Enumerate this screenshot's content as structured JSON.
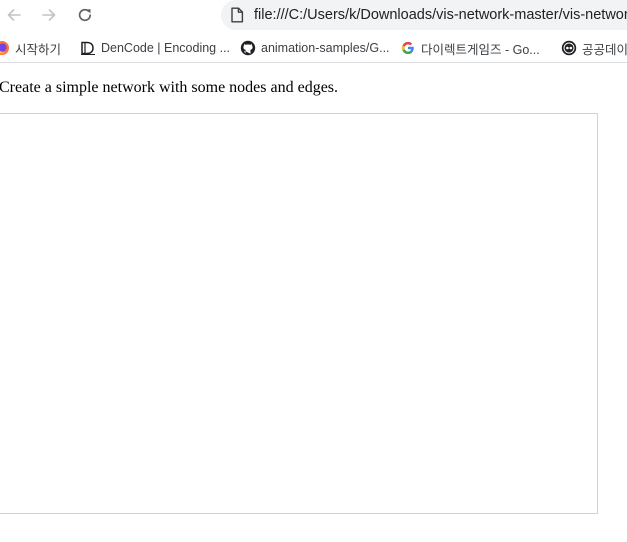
{
  "browser": {
    "nav": {
      "back_icon": "arrow-left-icon",
      "forward_icon": "arrow-right-icon",
      "reload_icon": "reload-icon"
    },
    "address": {
      "icon": "page-icon",
      "url": "file:///C:/Users/k/Downloads/vis-network-master/vis-network-master/examples/network/basic_usage/standalone.html"
    },
    "bookmarks": [
      {
        "label": "시작하기",
        "icon": "firefox-icon"
      },
      {
        "label": "DenCode | Encoding ...",
        "icon": "dencode-icon"
      },
      {
        "label": "animation-samples/G...",
        "icon": "github-icon"
      },
      {
        "label": "다이렉트게임즈 - Go...",
        "icon": "google-icon"
      },
      {
        "label": "공공데이터포털",
        "icon": "opendata-icon"
      }
    ]
  },
  "page": {
    "intro_text": "Create a simple network with some nodes and edges."
  },
  "colors": {
    "address_bg": "#f1f3f4",
    "nav_icon_disabled": "#c0c4c8",
    "nav_icon_active": "#5f6368",
    "network_border": "#d3d3d3"
  }
}
